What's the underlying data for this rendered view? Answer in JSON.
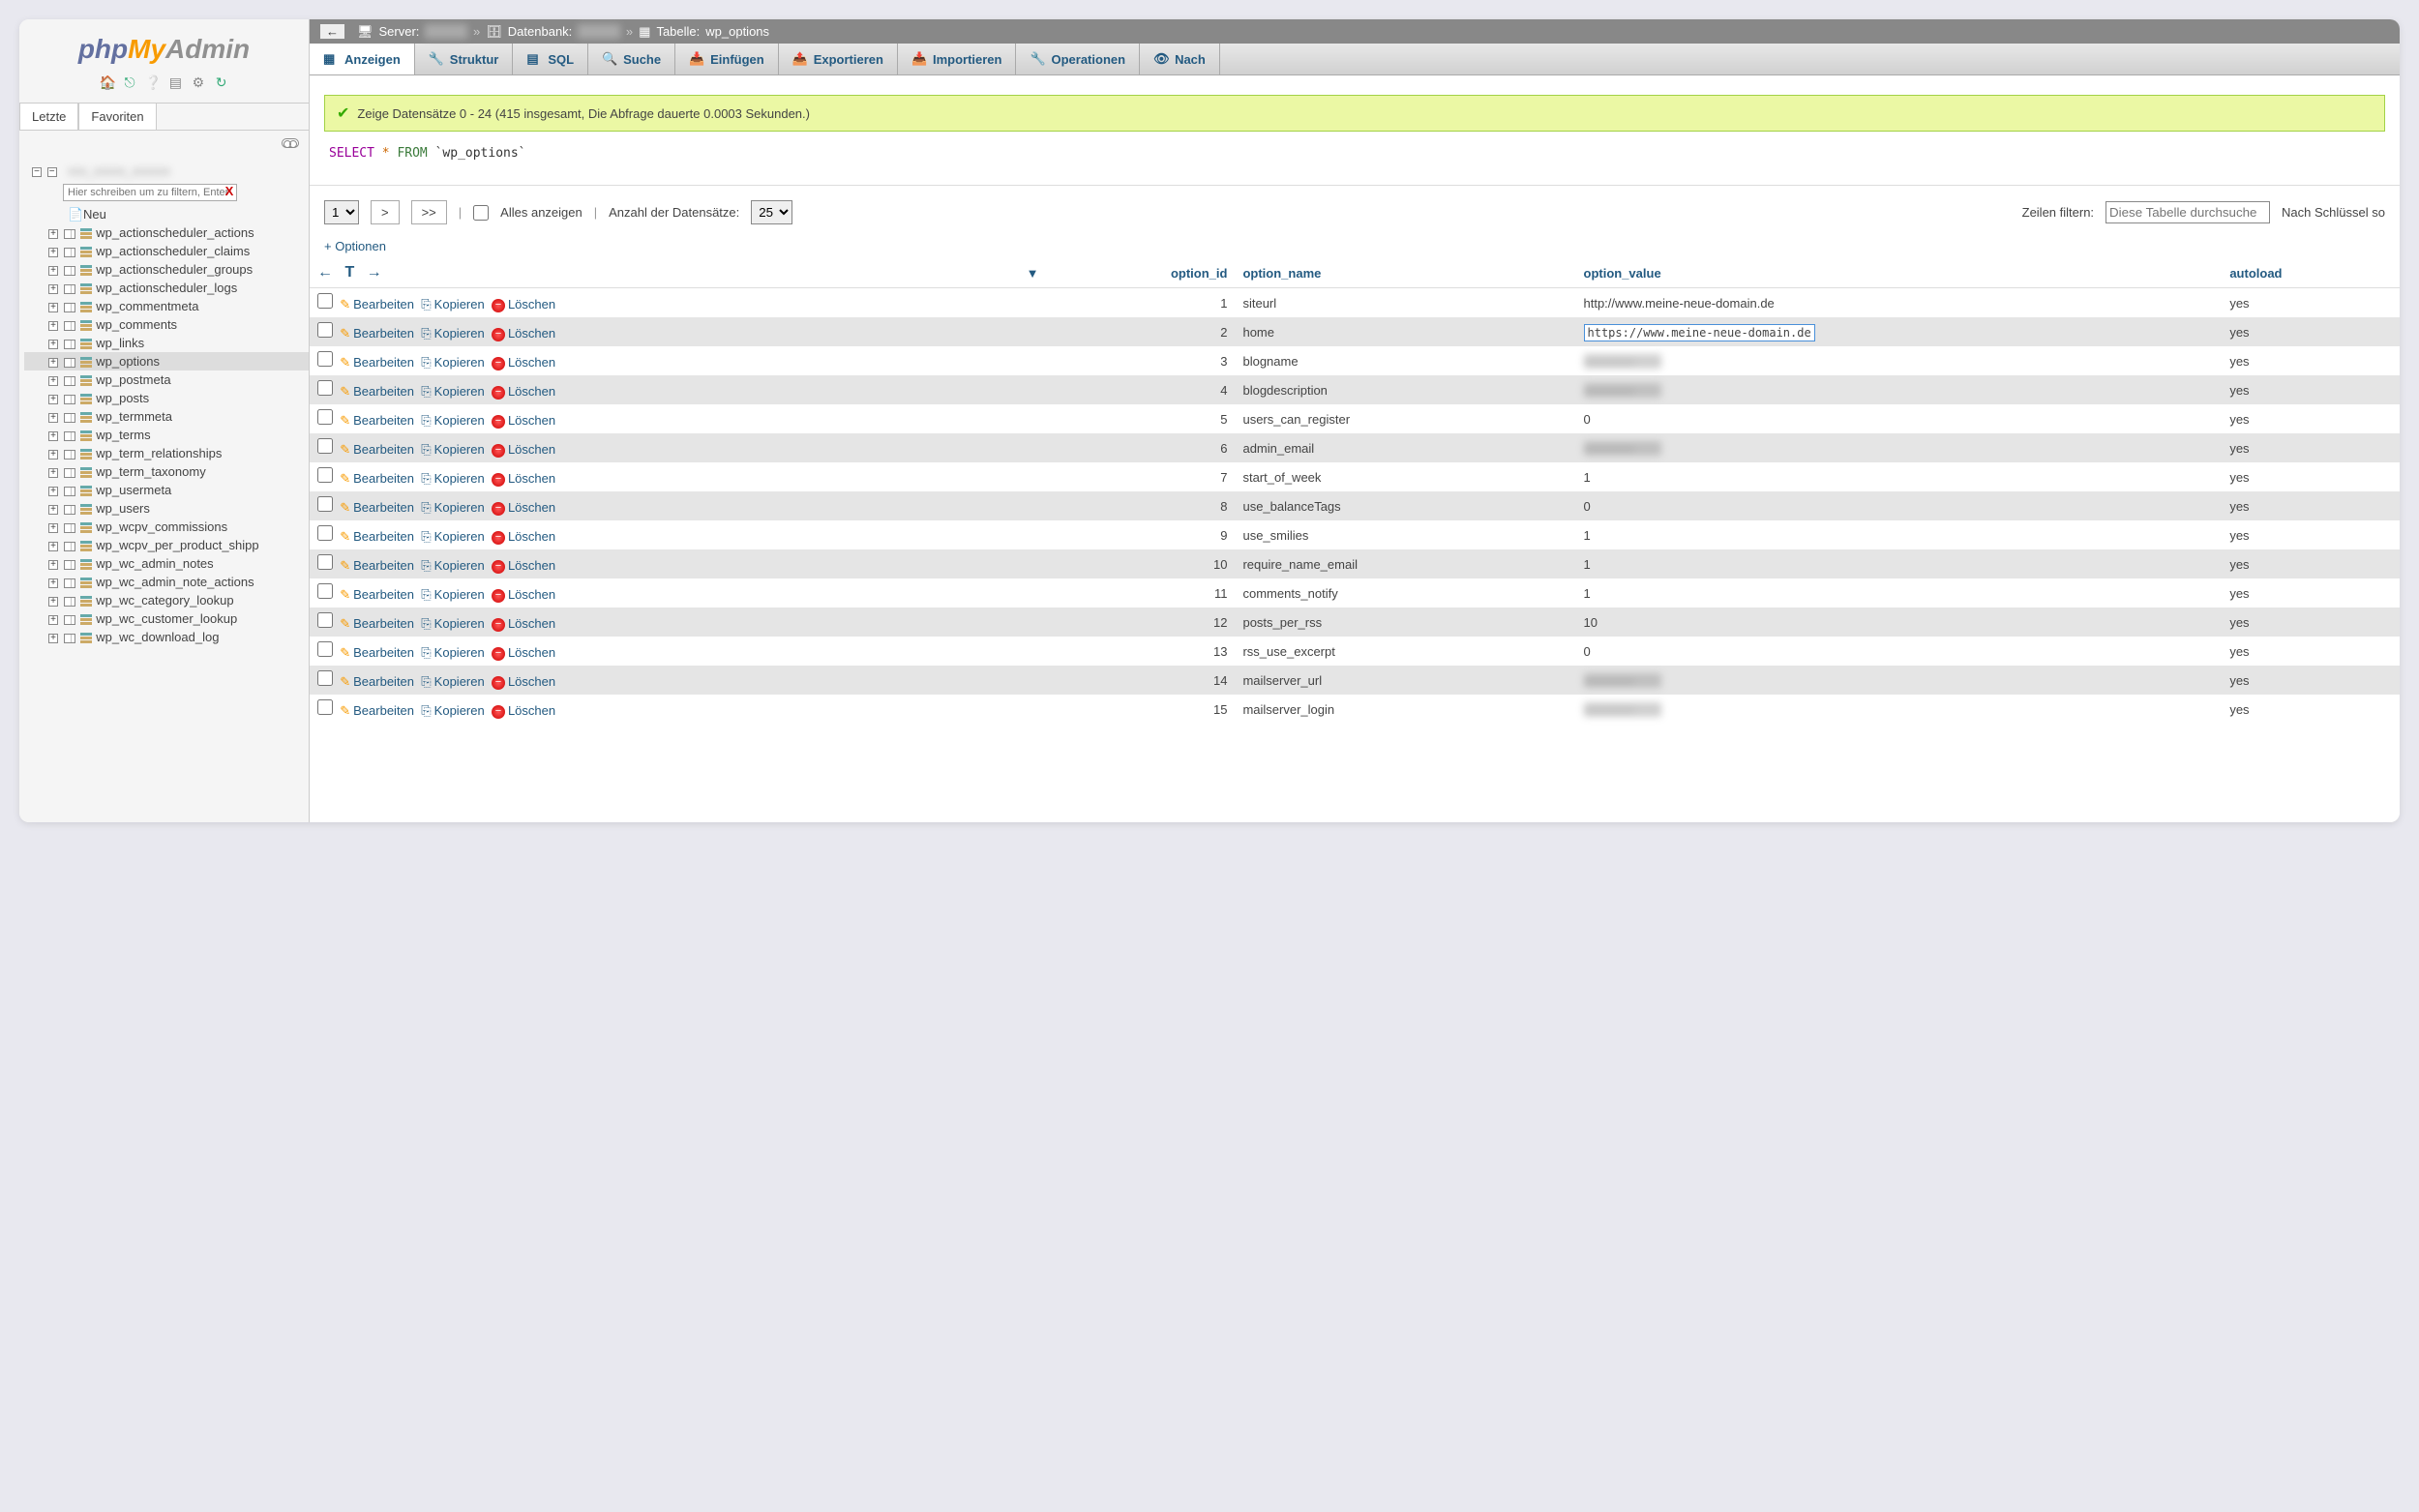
{
  "logo": {
    "php": "php",
    "my": "My",
    "admin": "Admin"
  },
  "sidebar_tabs": {
    "recent": "Letzte",
    "favorites": "Favoriten"
  },
  "filter_placeholder": "Hier schreiben um zu filtern, Enter",
  "tree": {
    "neu": "Neu",
    "tables": [
      "wp_actionscheduler_actions",
      "wp_actionscheduler_claims",
      "wp_actionscheduler_groups",
      "wp_actionscheduler_logs",
      "wp_commentmeta",
      "wp_comments",
      "wp_links",
      "wp_options",
      "wp_postmeta",
      "wp_posts",
      "wp_termmeta",
      "wp_terms",
      "wp_term_relationships",
      "wp_term_taxonomy",
      "wp_usermeta",
      "wp_users",
      "wp_wcpv_commissions",
      "wp_wcpv_per_product_shipp",
      "wp_wc_admin_notes",
      "wp_wc_admin_note_actions",
      "wp_wc_category_lookup",
      "wp_wc_customer_lookup",
      "wp_wc_download_log"
    ],
    "selected": "wp_options"
  },
  "breadcrumb": {
    "server_lbl": "Server:",
    "db_lbl": "Datenbank:",
    "tbl_lbl": "Tabelle:",
    "tbl": "wp_options",
    "sep": "»"
  },
  "tabs": [
    "Anzeigen",
    "Struktur",
    "SQL",
    "Suche",
    "Einfügen",
    "Exportieren",
    "Importieren",
    "Operationen",
    "Nach"
  ],
  "status": "Zeige Datensätze 0 - 24 (415 insgesamt, Die Abfrage dauerte 0.0003 Sekunden.)",
  "sql": {
    "select": "SELECT",
    "star": "*",
    "from": "FROM",
    "table": "`wp_options`"
  },
  "controls": {
    "page": "1",
    "next": ">",
    "last": ">>",
    "showall": "Alles anzeigen",
    "rowcount_lbl": "Anzahl der Datensätze:",
    "rowcount": "25",
    "filter_lbl": "Zeilen filtern:",
    "filter_ph": "Diese Tabelle durchsuche",
    "sort_lbl": "Nach Schlüssel so"
  },
  "options_link": "+ Optionen",
  "columns": [
    "option_id",
    "option_name",
    "option_value",
    "autoload"
  ],
  "actions": {
    "edit": "Bearbeiten",
    "copy": "Kopieren",
    "delete": "Löschen"
  },
  "rows": [
    {
      "id": "1",
      "name": "siteurl",
      "value": "http://www.meine-neue-domain.de",
      "autoload": "yes",
      "blur": false
    },
    {
      "id": "2",
      "name": "home",
      "value": "https://www.meine-neue-domain.de",
      "autoload": "yes",
      "blur": false,
      "editing": true
    },
    {
      "id": "3",
      "name": "blogname",
      "value": "",
      "autoload": "yes",
      "blur": true
    },
    {
      "id": "4",
      "name": "blogdescription",
      "value": "",
      "autoload": "yes",
      "blur": true
    },
    {
      "id": "5",
      "name": "users_can_register",
      "value": "0",
      "autoload": "yes",
      "blur": false
    },
    {
      "id": "6",
      "name": "admin_email",
      "value": "",
      "autoload": "yes",
      "blur": true
    },
    {
      "id": "7",
      "name": "start_of_week",
      "value": "1",
      "autoload": "yes",
      "blur": false
    },
    {
      "id": "8",
      "name": "use_balanceTags",
      "value": "0",
      "autoload": "yes",
      "blur": false
    },
    {
      "id": "9",
      "name": "use_smilies",
      "value": "1",
      "autoload": "yes",
      "blur": false
    },
    {
      "id": "10",
      "name": "require_name_email",
      "value": "1",
      "autoload": "yes",
      "blur": false
    },
    {
      "id": "11",
      "name": "comments_notify",
      "value": "1",
      "autoload": "yes",
      "blur": false
    },
    {
      "id": "12",
      "name": "posts_per_rss",
      "value": "10",
      "autoload": "yes",
      "blur": false
    },
    {
      "id": "13",
      "name": "rss_use_excerpt",
      "value": "0",
      "autoload": "yes",
      "blur": false
    },
    {
      "id": "14",
      "name": "mailserver_url",
      "value": "",
      "autoload": "yes",
      "blur": true
    },
    {
      "id": "15",
      "name": "mailserver_login",
      "value": "",
      "autoload": "yes",
      "blur": true
    }
  ]
}
